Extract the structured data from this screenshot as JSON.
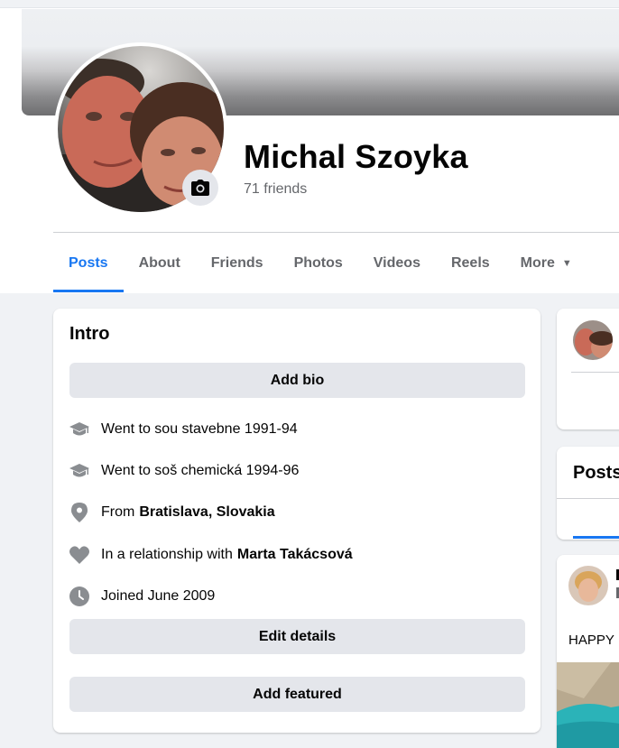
{
  "profile": {
    "name": "Michal Szoyka",
    "friends_count": "71 friends"
  },
  "tabs": [
    {
      "label": "Posts",
      "active": true
    },
    {
      "label": "About"
    },
    {
      "label": "Friends"
    },
    {
      "label": "Photos"
    },
    {
      "label": "Videos"
    },
    {
      "label": "Reels"
    },
    {
      "label": "More"
    }
  ],
  "intro": {
    "title": "Intro",
    "add_bio": "Add bio",
    "details": [
      {
        "icon": "graduation-cap-icon",
        "text": "Went to sou stavebne 1991-94"
      },
      {
        "icon": "graduation-cap-icon",
        "text": "Went to soš chemická 1994-96"
      },
      {
        "icon": "location-pin-icon",
        "text": "From",
        "bold": "Bratislava, Slovakia"
      },
      {
        "icon": "heart-icon",
        "text": "In a relationship with",
        "bold": "Marta Takácsová"
      },
      {
        "icon": "clock-icon",
        "text": "Joined June 2009"
      }
    ],
    "edit_details": "Edit details",
    "add_featured": "Add featured"
  },
  "right_column": {
    "posts_title": "Posts",
    "post_text": "HAPPY"
  },
  "colors": {
    "accent": "#1877f2",
    "background": "#f0f2f5",
    "button_gray": "#e4e6eb",
    "secondary_text": "#65676b"
  }
}
